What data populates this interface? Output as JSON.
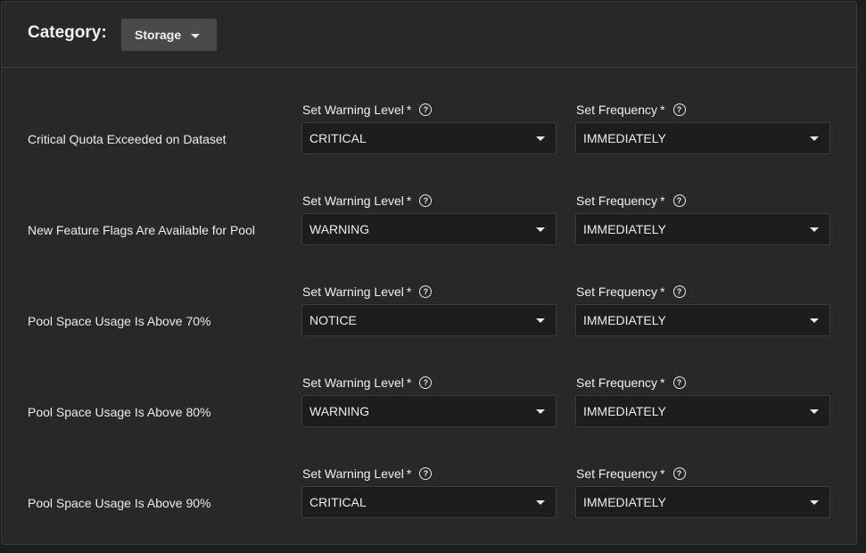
{
  "header": {
    "category_label": "Category:",
    "category_value": "Storage"
  },
  "labels": {
    "warning_level": "Set Warning Level",
    "frequency": "Set Frequency",
    "required_mark": "*",
    "help_glyph": "?"
  },
  "rows": [
    {
      "name": "Critical Quota Exceeded on Dataset",
      "level": "CRITICAL",
      "frequency": "IMMEDIATELY"
    },
    {
      "name": "New Feature Flags Are Available for Pool",
      "level": "WARNING",
      "frequency": "IMMEDIATELY"
    },
    {
      "name": "Pool Space Usage Is Above 70%",
      "level": "NOTICE",
      "frequency": "IMMEDIATELY"
    },
    {
      "name": "Pool Space Usage Is Above 80%",
      "level": "WARNING",
      "frequency": "IMMEDIATELY"
    },
    {
      "name": "Pool Space Usage Is Above 90%",
      "level": "CRITICAL",
      "frequency": "IMMEDIATELY"
    }
  ]
}
